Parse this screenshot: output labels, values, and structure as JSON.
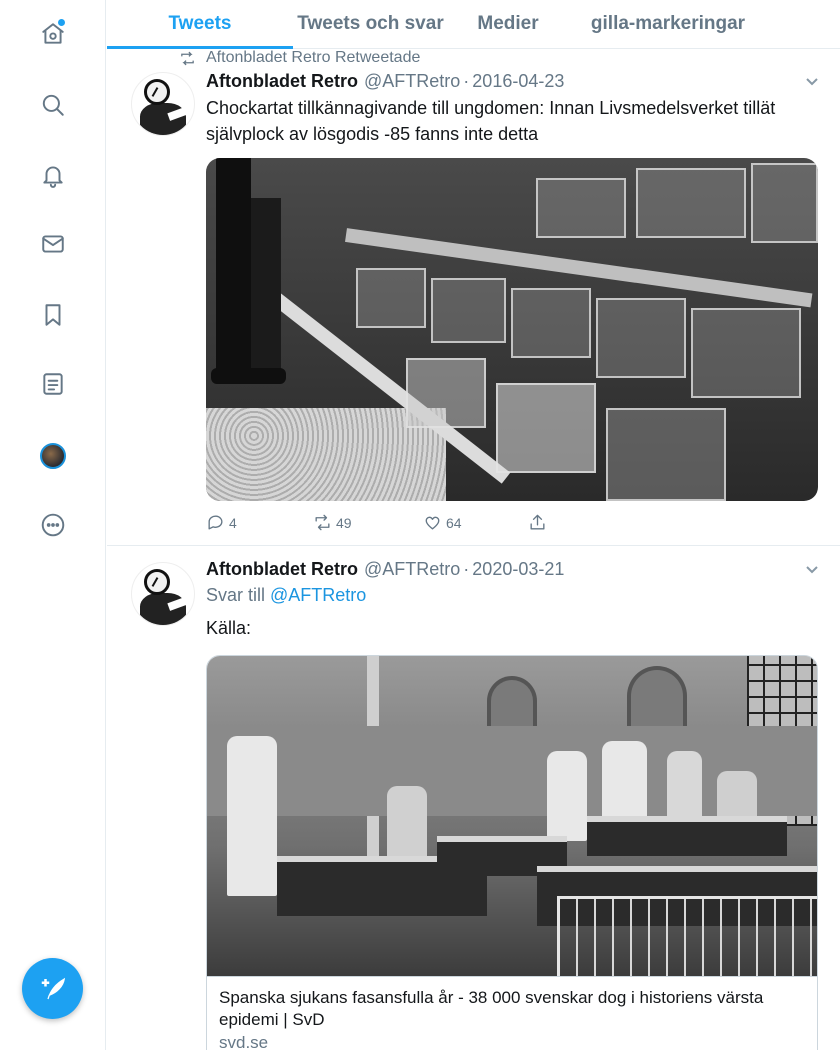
{
  "tabs": [
    {
      "label": "Tweets",
      "active": true
    },
    {
      "label": "Tweets och svar",
      "active": false
    },
    {
      "label": "Medier",
      "active": false
    },
    {
      "label": "gilla-markeringar",
      "active": false
    }
  ],
  "sidebar": {
    "icons": [
      "home-icon",
      "search-icon",
      "notifications-icon",
      "messages-icon",
      "bookmarks-icon",
      "lists-icon",
      "profile-avatar",
      "more-icon"
    ],
    "compose_icon": "compose-tweet-icon"
  },
  "tweets": [
    {
      "retweet_label": "Aftonbladet Retro Retweetade",
      "author_name": "Aftonbladet Retro",
      "handle": "@AFTRetro",
      "date": "2016-04-23",
      "text": "Chockartat tillkännagivande till ungdomen: Innan Livsmedelsverket tillät självplock av lösgodis -85 fanns inte detta",
      "media_description": "black-and-white candy bins in a shop",
      "stats": {
        "replies": "4",
        "retweets": "49",
        "likes": "64"
      }
    },
    {
      "author_name": "Aftonbladet Retro",
      "handle": "@AFTRetro",
      "date": "2020-03-21",
      "reply_prefix": "Svar till",
      "reply_handle": "@AFTRetro",
      "text": "Källa:",
      "link_card": {
        "title": "Spanska sjukans fasansfulla år - 38 000 svenskar dog i historiens värsta epidemi | SvD",
        "domain": "svd.se"
      }
    }
  ],
  "colors": {
    "accent": "#1da1f2",
    "secondary_text": "#657786",
    "divider": "#e6ecf0"
  }
}
